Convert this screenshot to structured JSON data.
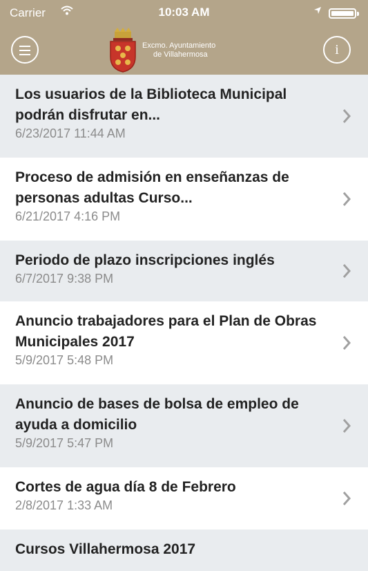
{
  "status": {
    "carrier": "Carrier",
    "time": "10:03 AM"
  },
  "header": {
    "org_line1": "Excmo. Ayuntamiento",
    "org_line2": "de Villahermosa"
  },
  "news": [
    {
      "title": "Los usuarios de la Biblioteca Municipal podrán disfrutar en...",
      "date": "6/23/2017 11:44 AM"
    },
    {
      "title": "Proceso de admisión en enseñanzas de personas adultas Curso...",
      "date": "6/21/2017 4:16 PM"
    },
    {
      "title": "Periodo de plazo inscripciones inglés",
      "date": "6/7/2017 9:38 PM"
    },
    {
      "title": "Anuncio trabajadores para el Plan de Obras Municipales 2017",
      "date": "5/9/2017 5:48 PM"
    },
    {
      "title": "Anuncio de bases de bolsa de empleo de ayuda a domicilio",
      "date": "5/9/2017 5:47 PM"
    },
    {
      "title": "Cortes de agua día 8 de Febrero",
      "date": "2/8/2017 1:33 AM"
    },
    {
      "title": "Cursos Villahermosa 2017",
      "date": ""
    }
  ],
  "colors": {
    "header": "#b4a58a",
    "row_alt": "#e9ecef",
    "date": "#8b8b8b"
  }
}
